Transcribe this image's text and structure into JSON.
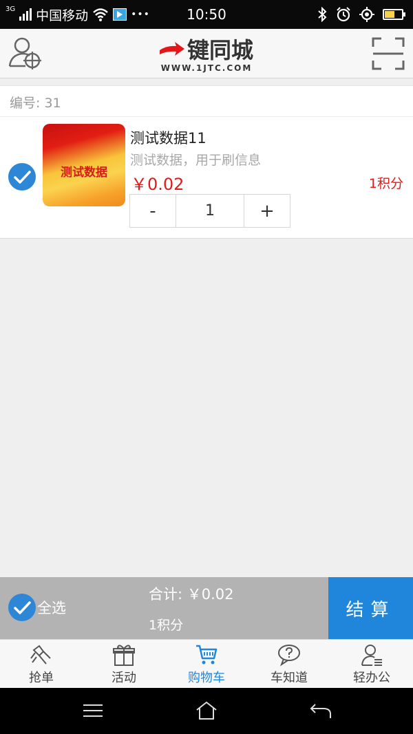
{
  "status_bar": {
    "network_type": "3G",
    "carrier": "中国移动",
    "more": "•••",
    "time": "10:50",
    "battery_level_percent": 60,
    "icons": [
      "signal-icon",
      "wifi-icon",
      "notification-flag-icon",
      "bluetooth-icon",
      "alarm-icon",
      "location-icon",
      "battery-icon"
    ]
  },
  "header": {
    "logo_text": "键同城",
    "logo_url_text": "WWW.1JTC.COM",
    "left_icon": "user-location-icon",
    "right_icon": "scan-icon"
  },
  "order": {
    "number_label": "编号:",
    "number_value": "31",
    "item": {
      "checked": true,
      "thumb_text": "测试数据",
      "title": "测试数据11",
      "description": "测试数据，用于刷信息",
      "price": "￥0.02",
      "points": "1积分",
      "minus": "-",
      "quantity": "1",
      "plus": "+"
    }
  },
  "summary": {
    "select_all_label": "全选",
    "total_label": "合计:",
    "total_value": "￥0.02",
    "total_points": "1积分",
    "checkout_label": "结算"
  },
  "tabs": [
    {
      "label": "抢单",
      "icon": "grab-order-icon",
      "active": false
    },
    {
      "label": "活动",
      "icon": "gift-icon",
      "active": false
    },
    {
      "label": "购物车",
      "icon": "cart-icon",
      "active": true
    },
    {
      "label": "车知道",
      "icon": "question-bubble-icon",
      "active": false
    },
    {
      "label": "轻办公",
      "icon": "office-user-icon",
      "active": false
    }
  ],
  "colors": {
    "accent": "#1f86dc",
    "price": "#e11b1b",
    "summary_bar": "#b3b3b3",
    "background": "#efefef"
  }
}
